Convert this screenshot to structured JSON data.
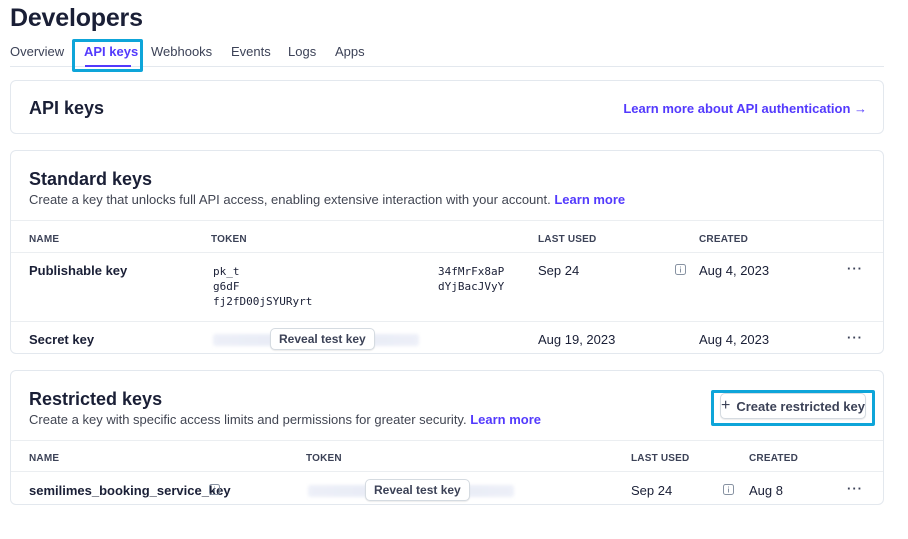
{
  "page": {
    "title": "Developers"
  },
  "tabs": [
    {
      "label": "Overview",
      "active": false
    },
    {
      "label": "API keys",
      "active": true
    },
    {
      "label": "Webhooks",
      "active": false
    },
    {
      "label": "Events",
      "active": false
    },
    {
      "label": "Logs",
      "active": false
    },
    {
      "label": "Apps",
      "active": false
    }
  ],
  "api_keys_card": {
    "title": "API keys",
    "link": "Learn more about API authentication →"
  },
  "standard_keys": {
    "title": "Standard keys",
    "description": "Create a key that unlocks full API access, enabling extensive interaction with your account.",
    "learn_more": "Learn more",
    "columns": {
      "name": "NAME",
      "token": "TOKEN",
      "last_used": "LAST USED",
      "created": "CREATED"
    },
    "rows": [
      {
        "name": "Publishable key",
        "token_col1": [
          "pk_t",
          "g6dF",
          "fj2fD00jSYURyrt"
        ],
        "token_col2": [
          "34fMrFx8aP",
          "dYjBacJVyY"
        ],
        "last_used": "Sep 24",
        "created": "Aug 4, 2023"
      },
      {
        "name": "Secret key",
        "reveal": "Reveal test key",
        "last_used": "Aug 19, 2023",
        "created": "Aug 4, 2023"
      }
    ]
  },
  "restricted_keys": {
    "title": "Restricted keys",
    "description": "Create a key with specific access limits and permissions for greater security.",
    "learn_more": "Learn more",
    "create_button": "Create restricted key",
    "columns": {
      "name": "NAME",
      "token": "TOKEN",
      "last_used": "LAST USED",
      "created": "CREATED"
    },
    "rows": [
      {
        "name": "semilimes_booking_service_key",
        "reveal": "Reveal test key",
        "last_used": "Sep 24",
        "created": "Aug 8"
      }
    ]
  },
  "more_label": "···",
  "colors": {
    "accent": "#533afd",
    "highlight": "#0ea5d9",
    "text": "#1a1f36",
    "border": "#e3e8ee"
  },
  "icons": {
    "info": "info-icon",
    "more": "more-icon",
    "plus": "plus-icon"
  }
}
